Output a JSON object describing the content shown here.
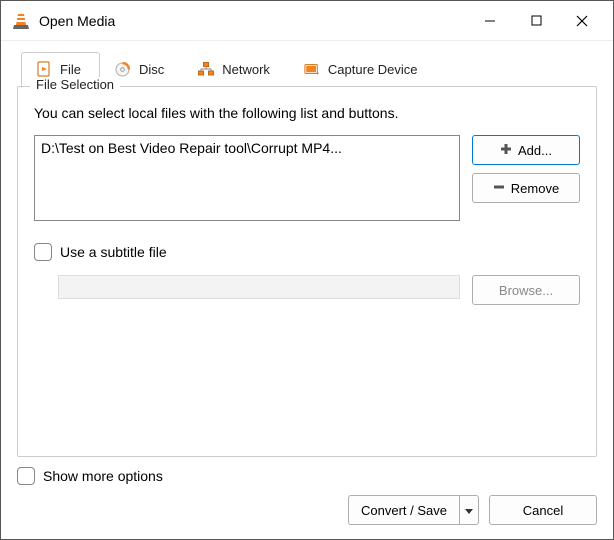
{
  "window": {
    "title": "Open Media"
  },
  "tabs": [
    {
      "label": "File",
      "icon": "file-icon"
    },
    {
      "label": "Disc",
      "icon": "disc-icon"
    },
    {
      "label": "Network",
      "icon": "network-icon"
    },
    {
      "label": "Capture Device",
      "icon": "capture-icon"
    }
  ],
  "file_selection": {
    "legend": "File Selection",
    "help": "You can select local files with the following list and buttons.",
    "files": [
      "D:\\Test on Best Video Repair tool\\Corrupt MP4..."
    ],
    "add_label": "Add...",
    "remove_label": "Remove",
    "subtitle_checkbox_label": "Use a subtitle file",
    "browse_label": "Browse..."
  },
  "footer": {
    "more_options_label": "Show more options",
    "convert_label": "Convert / Save",
    "cancel_label": "Cancel"
  }
}
